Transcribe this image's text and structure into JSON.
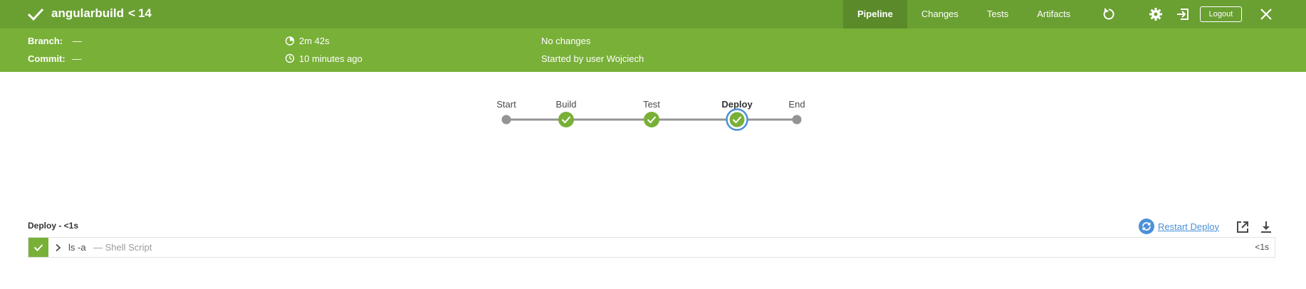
{
  "header": {
    "job_name": "angularbuild",
    "separator": "<",
    "run_number": "14",
    "tabs": [
      "Pipeline",
      "Changes",
      "Tests",
      "Artifacts"
    ],
    "active_tab": "Pipeline",
    "logout_label": "Logout",
    "icons": [
      "check-icon",
      "replay-icon",
      "gear-icon",
      "exit-icon",
      "close-icon"
    ]
  },
  "summary": {
    "branch_label": "Branch:",
    "branch_value": "—",
    "commit_label": "Commit:",
    "commit_value": "—",
    "duration": "2m 42s",
    "time_ago": "10 minutes ago",
    "changes": "No changes",
    "started_by": "Started by user Wojciech"
  },
  "pipeline": {
    "stages": [
      {
        "name": "Start",
        "status": "none"
      },
      {
        "name": "Build",
        "status": "success"
      },
      {
        "name": "Test",
        "status": "success"
      },
      {
        "name": "Deploy",
        "status": "success",
        "selected": true
      },
      {
        "name": "End",
        "status": "none"
      }
    ]
  },
  "detail": {
    "title": "Deploy - <1s",
    "restart_label": "Restart Deploy",
    "steps": [
      {
        "command": "ls -a",
        "type": "— Shell Script",
        "duration": "<1s",
        "status": "success"
      }
    ]
  },
  "colors": {
    "header_bg": "#6a9f32",
    "summary_bg": "#79b038",
    "success": "#78b037",
    "selected_ring": "#4a90d9",
    "link": "#4a90d9",
    "node_idle": "#949494"
  }
}
